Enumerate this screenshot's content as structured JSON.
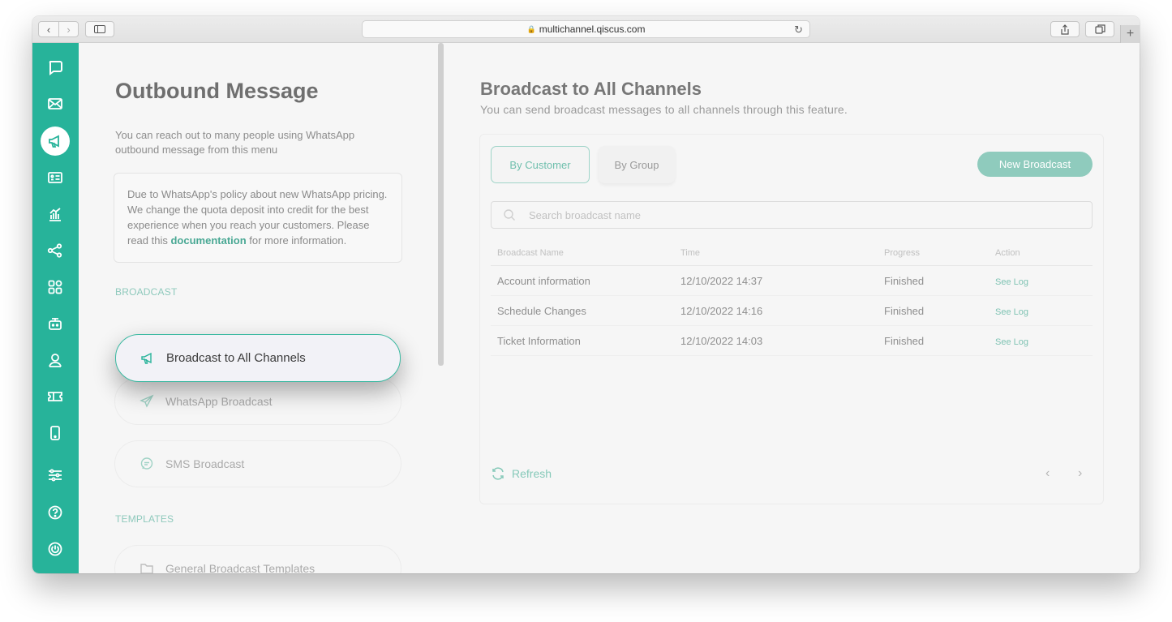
{
  "browser": {
    "url": "multichannel.qiscus.com"
  },
  "left_pane": {
    "title": "Outbound Message",
    "description": "You can reach out to many people using WhatsApp outbound message from this menu",
    "notice": {
      "text_before": "Due to WhatsApp's policy about new WhatsApp pricing. We change the quota deposit into credit for the best experience when you reach your customers. Please read this ",
      "link": "documentation",
      "text_after": " for more information."
    },
    "sections": [
      {
        "label": "BROADCAST",
        "items": [
          {
            "label": "Broadcast to All Channels",
            "icon": "megaphone-icon",
            "active": true
          },
          {
            "label": "WhatsApp Broadcast",
            "icon": "send-icon"
          },
          {
            "label": "SMS Broadcast",
            "icon": "sms-icon"
          }
        ]
      },
      {
        "label": "TEMPLATES",
        "items": [
          {
            "label": "General Broadcast Templates",
            "icon": "folder-icon"
          }
        ]
      }
    ]
  },
  "main": {
    "title": "Broadcast to All Channels",
    "subtitle": "You can send broadcast messages to all channels through this feature.",
    "tabs": [
      {
        "label": "By Customer",
        "active": true
      },
      {
        "label": "By Group"
      }
    ],
    "new_button": "New Broadcast",
    "search_placeholder": "Search broadcast name",
    "columns": [
      "Broadcast Name",
      "Time",
      "Progress",
      "Action"
    ],
    "rows": [
      {
        "name": "Account information",
        "time": "12/10/2022 14:37",
        "progress": "Finished",
        "action": "See Log"
      },
      {
        "name": "Schedule Changes",
        "time": "12/10/2022 14:16",
        "progress": "Finished",
        "action": "See Log"
      },
      {
        "name": "Ticket Information",
        "time": "12/10/2022 14:03",
        "progress": "Finished",
        "action": "See Log"
      }
    ],
    "refresh_label": "Refresh"
  },
  "colors": {
    "accent": "#27b39a",
    "accent_light": "#8fcbbd"
  }
}
